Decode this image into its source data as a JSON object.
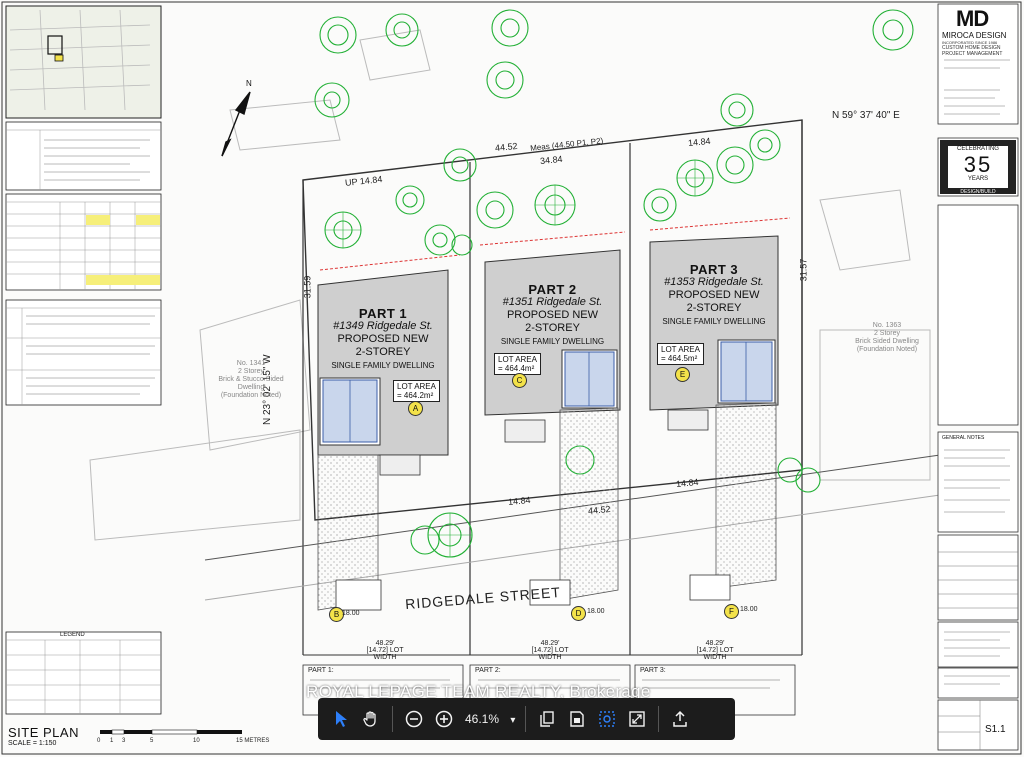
{
  "drawing": {
    "title": "SITE PLAN",
    "scale": "SCALE = 1:150",
    "scale_ticks": [
      "0",
      "1",
      "3",
      "5",
      "10",
      "15 METRES"
    ],
    "street_name": "RIDGEDALE STREET",
    "bearing": "N 59° 37' 40\" E",
    "bearing_side": "N 23° 02' 15\" W",
    "neighbor_left": [
      "No. 1341",
      "2 Storey",
      "Brick & Stucco Sided",
      "Dwelling",
      "(Foundation Noted)"
    ],
    "neighbor_right": [
      "No. 1363",
      "2 Storey",
      "Brick Sided Dwelling",
      "(Foundation Noted)"
    ],
    "dims": {
      "top_total": "44.52",
      "top_meas": "Meas (44.50 P1, P2)",
      "top_a": "34.84",
      "top_b": "14.84",
      "up_a": "UP 14.84",
      "side_left": "31.59",
      "side_right": "31.57",
      "bottom_a": "14.84",
      "bottom_b": "14.84",
      "bottom_c": "44.52",
      "lot_width_label": "48.29'",
      "lot_width_sub": "[14.72] LOT WIDTH",
      "setback": "18.00"
    },
    "parts": [
      {
        "part": "PART 1",
        "addr": "#1349 Ridgedale St.",
        "line1": "PROPOSED NEW",
        "line2": "2-STOREY",
        "line3": "SINGLE FAMILY DWELLING",
        "lot_area_label": "LOT AREA",
        "lot_area": "= 464.2m²",
        "marker": "A",
        "drive": "B"
      },
      {
        "part": "PART 2",
        "addr": "#1351 Ridgedale St.",
        "line1": "PROPOSED NEW",
        "line2": "2-STOREY",
        "line3": "SINGLE FAMILY DWELLING",
        "lot_area_label": "LOT AREA",
        "lot_area": "= 464.4m²",
        "marker": "C",
        "drive": "D"
      },
      {
        "part": "PART 3",
        "addr": "#1353 Ridgedale St.",
        "line1": "PROPOSED NEW",
        "line2": "2-STOREY",
        "line3": "SINGLE FAMILY DWELLING",
        "lot_area_label": "LOT AREA",
        "lot_area": "= 464.5m²",
        "marker": "E",
        "drive": "F"
      }
    ],
    "bottom_parts": [
      "PART 1:",
      "PART 2:",
      "PART 3:"
    ]
  },
  "titleblock": {
    "logo": "MD",
    "company": "MIROCA DESIGN",
    "tagline": "INCORPORATED SINCE 1986",
    "services": [
      "CUSTOM HOME DESIGN",
      "PROJECT MANAGEMENT"
    ],
    "badge_top": "CELEBRATING",
    "badge_num": "35",
    "badge_years": "YEARS",
    "badge_bottom": "DESIGN/BUILD",
    "notes_title": "GENERAL NOTES",
    "sheet_no": "S1.1"
  },
  "legend": {
    "title": "LEGEND"
  },
  "viewer": {
    "watermark": "ROYAL LEPAGE TEAM REALTY, Brokerage",
    "zoom": "46.1%",
    "zoom_caret": "▾",
    "accent": "#2d7ff9"
  },
  "icons": {
    "select": "arrow-pointer",
    "pan": "hand",
    "zoom_out": "minus-circle",
    "zoom_in": "plus-circle",
    "pages": "copy",
    "fit_page": "fit-page",
    "marquee": "marquee-zoom",
    "fullscreen": "expand",
    "share": "upload"
  }
}
